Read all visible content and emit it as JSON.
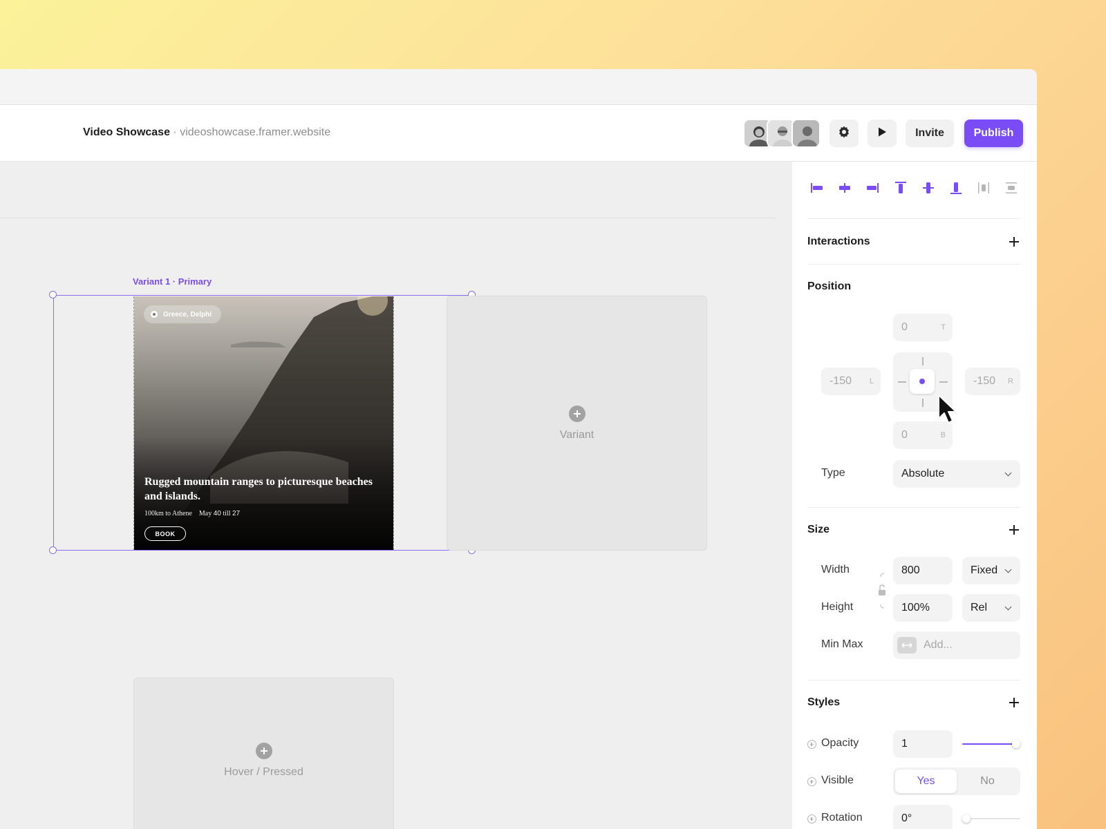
{
  "toolbar": {
    "project_name": "Video Showcase",
    "separator": "·",
    "project_url": "videoshowcase.framer.website",
    "collaborators": [
      "avatar-1",
      "avatar-2",
      "avatar-3"
    ],
    "settings_icon": "gear-icon",
    "preview_icon": "play-icon",
    "invite_label": "Invite",
    "publish_label": "Publish",
    "accent_color": "#7a4cf5"
  },
  "canvas": {
    "selected_variant_label": "Variant 1 · Primary",
    "card": {
      "location": "Greece, Delphi",
      "title": "Rugged mountain ranges to picturesque beaches and islands.",
      "meta_distance": "100km to Athene",
      "meta_month": "May",
      "meta_start": "40",
      "meta_till": "till",
      "meta_end": "27",
      "book_label": "BOOK"
    },
    "empty_variants": [
      {
        "label": "Variant"
      },
      {
        "label": "Hover / Pressed"
      }
    ]
  },
  "panel": {
    "align_icons": [
      "align-left-icon",
      "align-center-h-icon",
      "align-right-icon",
      "align-top-icon",
      "align-center-v-icon",
      "align-bottom-icon",
      "distribute-h-icon",
      "distribute-v-icon"
    ],
    "interactions": {
      "title": "Interactions"
    },
    "position": {
      "title": "Position",
      "top": {
        "value": "0",
        "suffix": "T"
      },
      "left": {
        "value": "-150",
        "suffix": "L"
      },
      "right": {
        "value": "-150",
        "suffix": "R"
      },
      "bottom": {
        "value": "0",
        "suffix": "B"
      },
      "type_label": "Type",
      "type_value": "Absolute"
    },
    "size": {
      "title": "Size",
      "width_label": "Width",
      "width_value": "800",
      "width_mode": "Fixed",
      "height_label": "Height",
      "height_value": "100%",
      "height_mode": "Rel",
      "minmax_label": "Min Max",
      "minmax_placeholder": "Add..."
    },
    "styles": {
      "title": "Styles",
      "opacity_label": "Opacity",
      "opacity_value": "1",
      "opacity_level": 1,
      "visible_label": "Visible",
      "visible_yes": "Yes",
      "visible_no": "No",
      "rotation_label": "Rotation",
      "rotation_value": "0°",
      "rotation_level": 0
    }
  }
}
